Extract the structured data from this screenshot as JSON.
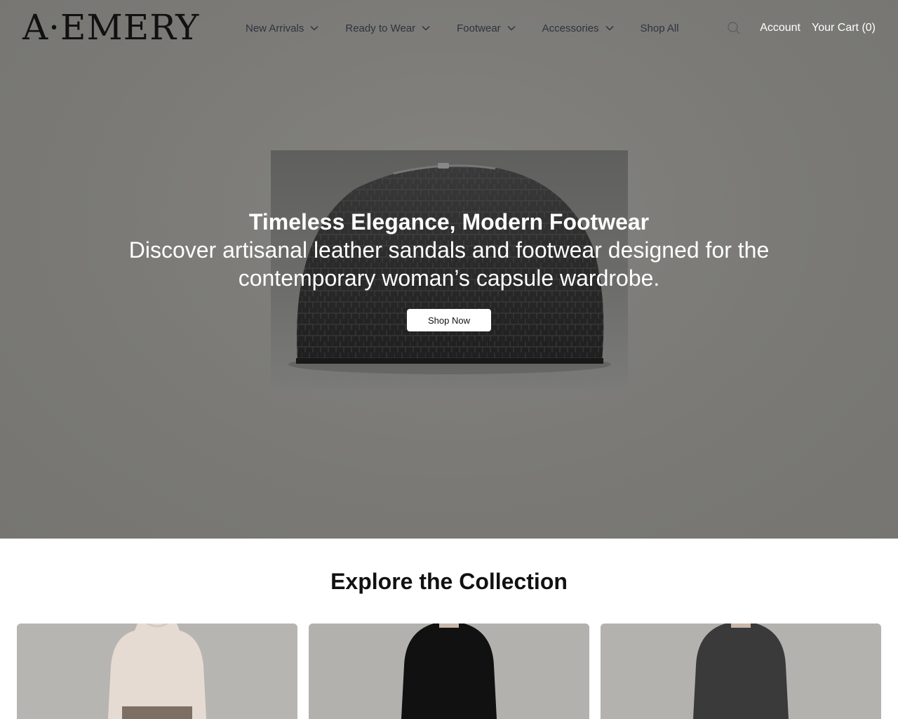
{
  "brand": {
    "logo_text": "A·EMERY"
  },
  "nav": {
    "items": [
      {
        "label": "New Arrivals",
        "has_dropdown": true
      },
      {
        "label": "Ready to Wear",
        "has_dropdown": true
      },
      {
        "label": "Footwear",
        "has_dropdown": true
      },
      {
        "label": "Accessories",
        "has_dropdown": true
      },
      {
        "label": "Shop All",
        "has_dropdown": false
      }
    ]
  },
  "header": {
    "search_icon": "search-icon",
    "account_label": "Account",
    "cart_label": "Your Cart (0)"
  },
  "hero": {
    "title": "Timeless Elegance, Modern Footwear",
    "subtitle": "Discover artisanal leather sandals and footwear designed for the contemporary woman’s capsule wardrobe.",
    "cta_label": "Shop Now"
  },
  "collection": {
    "title": "Explore the Collection",
    "cards": [
      {
        "sweater_color": "#e6dbd3",
        "bottom_color": "#7d6f64"
      },
      {
        "sweater_color": "#111111",
        "bottom_color": "#1a1a1a"
      },
      {
        "sweater_color": "#3a3a3a",
        "bottom_color": "#2a2a2a"
      }
    ]
  },
  "colors": {
    "hero_bg": "#7b7a76",
    "nav_text": "#2e3340",
    "white": "#ffffff",
    "text_dark": "#111111"
  }
}
